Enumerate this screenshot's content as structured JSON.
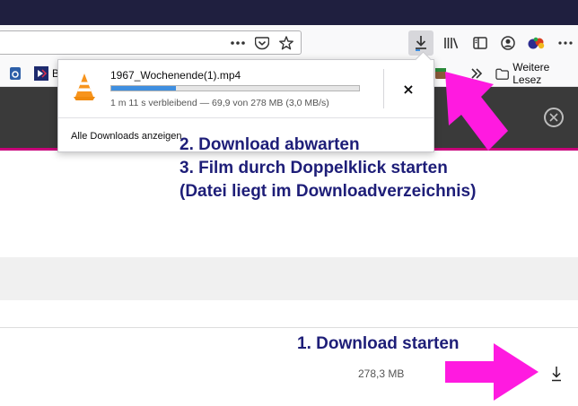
{
  "colors": {
    "accent_magenta": "#ff1ae0",
    "annotation_text": "#1e1e78",
    "progress_fill": "#3f8fe0",
    "titlebar": "#1f1f3f"
  },
  "toolbar": {
    "icons": [
      "more-icon",
      "pocket-icon",
      "bookmark-star-icon",
      "download-icon",
      "library-icon",
      "sidebar-icon",
      "account-icon",
      "extension-icon",
      "overflow-icon"
    ]
  },
  "bookmarks": {
    "partial_item": "B",
    "overflow_icon": "chevron-double-right-icon",
    "folder_label": "Weitere Lesez"
  },
  "download_panel": {
    "file_name": "1967_Wochenende(1).mp4",
    "status": "1 m 11 s verbleibend — 69,9 von 278 MB (3,0 MB/s)",
    "progress": 0.26,
    "cancel_label": "×",
    "show_all": "Alle Downloads anzeigen"
  },
  "annotations": {
    "step2": "2. Download abwarten",
    "step3": "3. Film durch Doppelklick starten",
    "step3_note": "(Datei liegt im Downloadverzeichnis)",
    "step1": "1. Download starten"
  },
  "page": {
    "file_size": "278,3 MB"
  }
}
